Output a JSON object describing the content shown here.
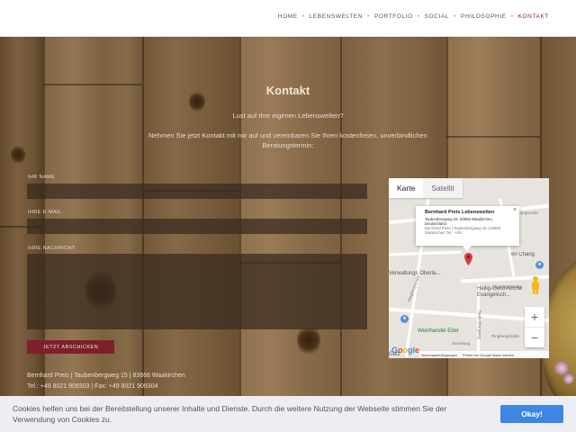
{
  "nav": {
    "items": [
      {
        "label": "HOME",
        "active": false
      },
      {
        "label": "LEBENSWELTEN",
        "active": false
      },
      {
        "label": "PORTFOLIO",
        "active": false
      },
      {
        "label": "SOCIAL",
        "active": false
      },
      {
        "label": "PHILOSOPHIE",
        "active": false
      },
      {
        "label": "KONTAKT",
        "active": true
      }
    ],
    "active_color": "#8b2433"
  },
  "contact": {
    "title": "Kontakt",
    "subtitle": "Lust auf Ihre eigenen Lebenswelten?",
    "intro": "Nehmen Sie jetzt Kontakt mit mir auf und vereinbaren Sie Ihren kostenfreien, unverbindlichen Beratungstermin:",
    "name_label": "IHR NAME",
    "email_label": "IHRE E-MAIL",
    "message_label": "IHRE NACHRICHT",
    "name_value": "",
    "email_value": "",
    "message_value": "",
    "submit_label": "JETZT ABSCHICKEN",
    "submit_color": "#7e1f2b",
    "address_line1": "Bernhard Preis | Taubenbergweg 15 | 83666 Waakirchen",
    "address_line2": "Tel.: +49 8021 909303 | Fax: +49 8021 909304"
  },
  "map": {
    "tab_map": "Karte",
    "tab_satellite": "Satellit",
    "info_title": "Bernhard Preis Lebenswelten",
    "info_address": "Taubenbergweg 15, 83666 Waakirchen, Deutschland",
    "info_detail": "Bernhard Preis | Taubenbergweg 15 | 83666 Waakirchen Tel.: +49...",
    "close": "×",
    "poi_church": "Heilig-Geist-Kirche Evangelisch...",
    "poi_wine": "Weinhandel Eder",
    "poi_admin": "Verwaltungs Oberla...",
    "poi_clinic": "Getz",
    "poi_chang": "en Chang",
    "street_1": "Lettenstraße",
    "street_2": "Ringbergstraße",
    "street_3": "Ringbergstraße",
    "street_4": "Hirsebergstraße",
    "street_5": "Taubenbergweg",
    "street_6": "Zeiselweg",
    "street_7": "Ringbergstraße",
    "zoom_in": "+",
    "zoom_out": "−",
    "logo": "Google",
    "terms": "Nutzungsbedingungen",
    "report": "Fehler bei Google Maps melden",
    "pin_color": "#d23c3c"
  },
  "cookie": {
    "text": "Cookies helfen uns bei der Bereitstellung unserer Inhalte und Dienste. Durch die weitere Nutzung der Webseite stimmen Sie der Verwendung von Cookies zu.",
    "button": "Okay!",
    "button_color": "#3f86e4"
  }
}
